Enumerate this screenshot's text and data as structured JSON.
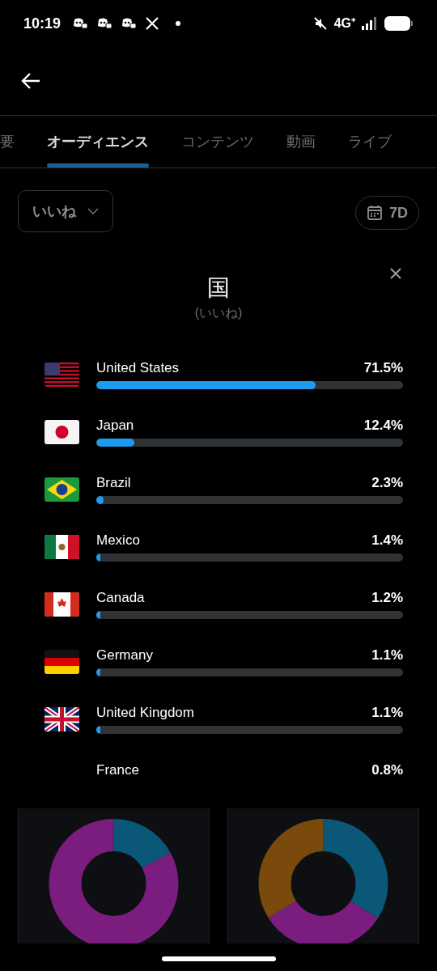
{
  "status_bar": {
    "time": "10:19",
    "network": "4G⁺"
  },
  "tabs": [
    {
      "label": "要",
      "selected": false
    },
    {
      "label": "オーディエンス",
      "selected": true
    },
    {
      "label": "コンテンツ",
      "selected": false
    },
    {
      "label": "動画",
      "selected": false
    },
    {
      "label": "ライブ",
      "selected": false
    }
  ],
  "filter": {
    "metric": "いいね",
    "period": "7D"
  },
  "panel": {
    "title": "国",
    "subtitle": "(いいね)",
    "countries": [
      {
        "name": "United States",
        "value": "71.5%",
        "level": 0.715,
        "kind": "us"
      },
      {
        "name": "Japan",
        "value": "12.4%",
        "level": 0.124,
        "kind": "jp"
      },
      {
        "name": "Brazil",
        "value": "2.3%",
        "level": 0.023,
        "kind": "br"
      },
      {
        "name": "Mexico",
        "value": "1.4%",
        "level": 0.014,
        "kind": "mx"
      },
      {
        "name": "Canada",
        "value": "1.2%",
        "level": 0.012,
        "kind": "ca"
      },
      {
        "name": "Germany",
        "value": "1.1%",
        "level": 0.011,
        "kind": "de"
      },
      {
        "name": "United Kingdom",
        "value": "1.1%",
        "level": 0.011,
        "kind": "gb"
      },
      {
        "name": "France",
        "value": "0.8%"
      }
    ]
  }
}
